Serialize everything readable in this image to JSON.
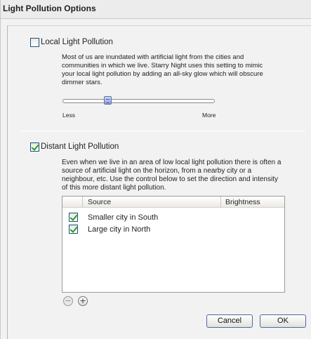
{
  "window": {
    "title": "Light Pollution Options"
  },
  "local": {
    "label": "Local Light Pollution",
    "checked": false,
    "description": [
      "Most of us are inundated with artificial light from the cities and",
      "communities in which we live. Starry Night uses this setting to mimic",
      "your local light pollution by adding an all-sky glow which will obscure",
      "dimmer stars."
    ],
    "slider": {
      "value_fraction": 0.3,
      "min_label": "Less",
      "max_label": "More"
    }
  },
  "distant": {
    "label": "Distant Light Pollution",
    "checked": true,
    "description": [
      "Even when we live in an area of low local light pollution there is often a",
      "source of artificial light on the horizon, from a nearby city or a",
      "neighbour, etc. Use the control below to set the direction and intensity",
      "of this more distant light pollution."
    ],
    "table": {
      "columns": [
        "Source",
        "Brightness"
      ],
      "rows": [
        {
          "checked": true,
          "source": "Smaller city in South",
          "brightness": ""
        },
        {
          "checked": true,
          "source": "Large city in North",
          "brightness": ""
        }
      ]
    },
    "remove_icon": "minus-circle-icon",
    "add_icon": "plus-circle-icon"
  },
  "buttons": {
    "cancel": "Cancel",
    "ok": "OK"
  },
  "colors": {
    "check_mark": "#21a121",
    "button_border": "#4a6aa0"
  }
}
